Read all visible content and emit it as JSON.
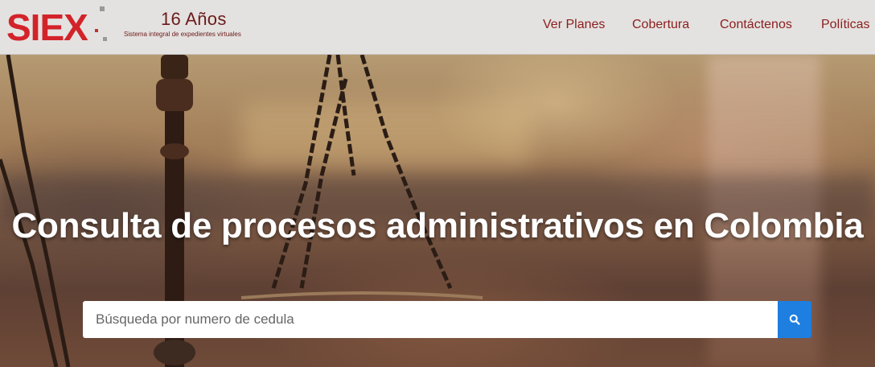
{
  "header": {
    "logo_text": "SIEX",
    "years": "16 Años",
    "tagline": "Sistema integral de expedientes virtuales"
  },
  "nav": {
    "items": [
      {
        "label": "Ver Planes"
      },
      {
        "label": "Cobertura"
      },
      {
        "label": "Contáctenos"
      },
      {
        "label": "Políticas"
      }
    ]
  },
  "hero": {
    "title": "Consulta de procesos administrativos en Colombia"
  },
  "search": {
    "placeholder": "Búsqueda por numero de cedula",
    "icon": "search-icon"
  },
  "colors": {
    "brand_red": "#d3232a",
    "nav_text": "#8b2020",
    "header_bg": "#e4e2e0",
    "search_button": "#1e7fe0"
  }
}
